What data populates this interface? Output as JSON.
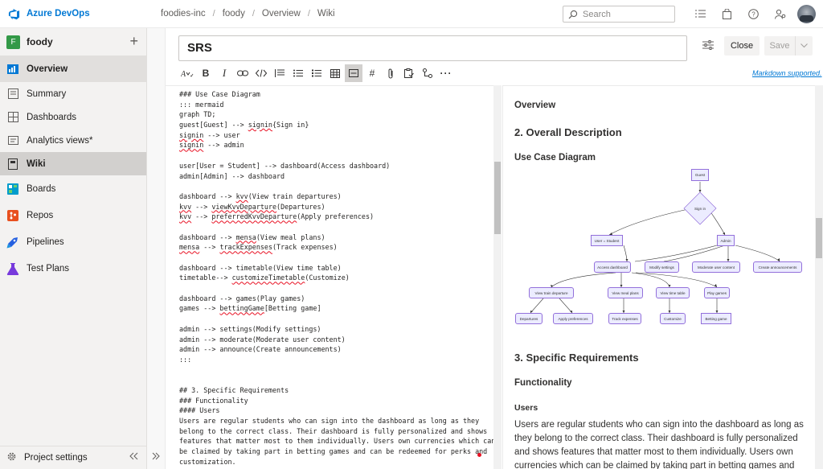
{
  "app": {
    "name": "Azure DevOps"
  },
  "breadcrumb": [
    "foodies-inc",
    "foody",
    "Overview",
    "Wiki"
  ],
  "search": {
    "placeholder": "Search"
  },
  "project": {
    "name": "foody",
    "badge": "F"
  },
  "nav": {
    "overview": "Overview",
    "summary": "Summary",
    "dashboards": "Dashboards",
    "analytics": "Analytics views*",
    "wiki": "Wiki",
    "boards": "Boards",
    "repos": "Repos",
    "pipelines": "Pipelines",
    "testplans": "Test Plans",
    "settings": "Project settings"
  },
  "page": {
    "title": "SRS",
    "close_label": "Close",
    "save_label": "Save",
    "markdown_link": "Markdown supported."
  },
  "editor_lines": [
    {
      "t": "### Use Case Diagram"
    },
    {
      "t": "::: mermaid"
    },
    {
      "t": "graph TD;"
    },
    {
      "t": "guest[Guest] --> ",
      "w": "signin",
      "r": "{Sign in}"
    },
    {
      "w": "signin",
      "r": " --> user"
    },
    {
      "w": "signin",
      "r": " --> admin"
    },
    {
      "t": ""
    },
    {
      "t": "user[User = Student] --> dashboard(Access dashboard)"
    },
    {
      "t": "admin[Admin] --> dashboard"
    },
    {
      "t": ""
    },
    {
      "t": "dashboard --> ",
      "w": "kvv",
      "r": "(View train departures)"
    },
    {
      "w": "kvv",
      "r": " --> ",
      "w2": "viewKvvDeparture",
      "r2": "(Departures)"
    },
    {
      "w": "kvv",
      "r": " --> ",
      "w2": "preferredKvvDeparture",
      "r2": "(Apply preferences)"
    },
    {
      "t": ""
    },
    {
      "t": "dashboard --> ",
      "w": "mensa",
      "r": "(View meal plans)"
    },
    {
      "w": "mensa",
      "r": " --> ",
      "w2": "trackExpenses",
      "r2": "(Track expenses)"
    },
    {
      "t": ""
    },
    {
      "t": "dashboard --> timetable(View time table)"
    },
    {
      "t": "timetable--> ",
      "w": "customizeTimetable",
      "r": "(Customize)"
    },
    {
      "t": ""
    },
    {
      "t": "dashboard --> games(Play games)"
    },
    {
      "t": "games --> ",
      "w": "bettingGame",
      "r": "[Betting game]"
    },
    {
      "t": ""
    },
    {
      "t": "admin --> settings(Modify settings)"
    },
    {
      "t": "admin --> moderate(Moderate user content)"
    },
    {
      "t": "admin --> announce(Create announcements)"
    },
    {
      "t": ":::"
    },
    {
      "t": ""
    },
    {
      "t": ""
    },
    {
      "t": "## 3. Specific Requirements"
    },
    {
      "t": "### Functionality"
    },
    {
      "t": "#### Users"
    },
    {
      "t": "Users are regular students who can sign into the dashboard as long as they"
    },
    {
      "t": "belong to the correct class. Their dashboard is fully personalized and shows"
    },
    {
      "t": "features that matter most to them individually. Users own currencies which can"
    },
    {
      "t": "be claimed by taking part in betting games and can be redeemed for perks and"
    },
    {
      "t": "customization."
    }
  ],
  "preview": {
    "overview": "Overview",
    "h_overall": "2. Overall Description",
    "h_usecase": "Use Case Diagram",
    "h_specific": "3. Specific Requirements",
    "h_functionality": "Functionality",
    "h_users": "Users",
    "users_text": "Users are regular students who can sign into the dashboard as long as they belong to the correct class. Their dashboard is fully personalized and shows features that matter most to them individually. Users own currencies which can be claimed by taking part in betting games and can be redeemed for"
  },
  "diagram": {
    "guest": "Guest",
    "signin": "Sign in",
    "user": "User = Student",
    "admin": "Admin",
    "dashboard": "Access dashboard",
    "settings": "Modify settings",
    "moderate": "Moderate user content",
    "announce": "Create announcements",
    "kvv": "View train departure",
    "mensa": "View meal plans",
    "timetable": "View time table",
    "games": "Play games",
    "departures": "Departures",
    "preferences": "Apply preferences",
    "expenses": "Track expenses",
    "customize": "Customize",
    "betting": "Betting game"
  },
  "colors": {
    "brand": "#0078d4",
    "project_badge": "#339947",
    "node_fill": "#ececff",
    "node_border": "#9370db"
  }
}
